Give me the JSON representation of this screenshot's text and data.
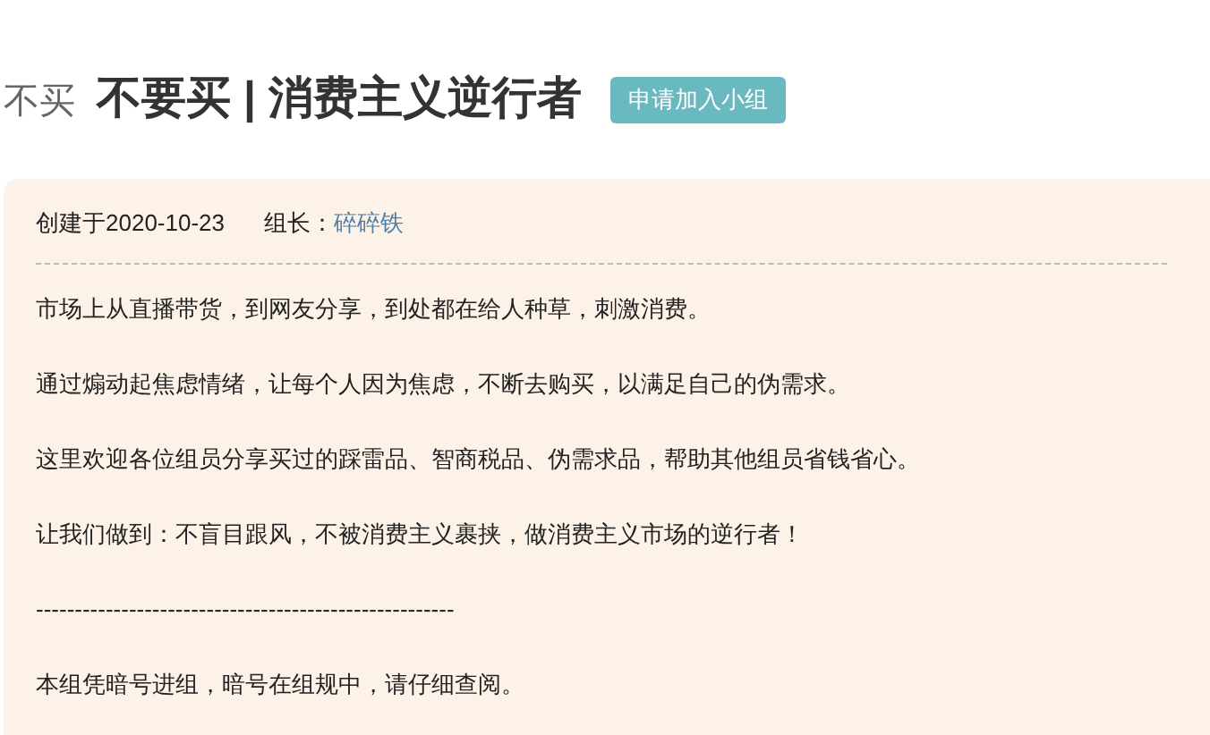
{
  "group": {
    "logo": "不买",
    "title": "不要买 | 消费主义逆行者",
    "join_button": "申请加入小组"
  },
  "info": {
    "created": "创建于2020-10-23",
    "leader_label": "组长：",
    "leader": "碎碎铁"
  },
  "paragraphs": [
    "市场上从直播带货，到网友分享，到处都在给人种草，刺激消费。",
    "通过煽动起焦虑情绪，让每个人因为焦虑，不断去购买，以满足自己的伪需求。",
    "这里欢迎各位组员分享买过的踩雷品、智商税品、伪需求品，帮助其他组员省钱省心。",
    "让我们做到：不盲目跟风，不被消费主义裹挟，做消费主义市场的逆行者！",
    "------------------------------------------------------",
    "本组凭暗号进组，暗号在组规中，请仔细查阅。"
  ]
}
